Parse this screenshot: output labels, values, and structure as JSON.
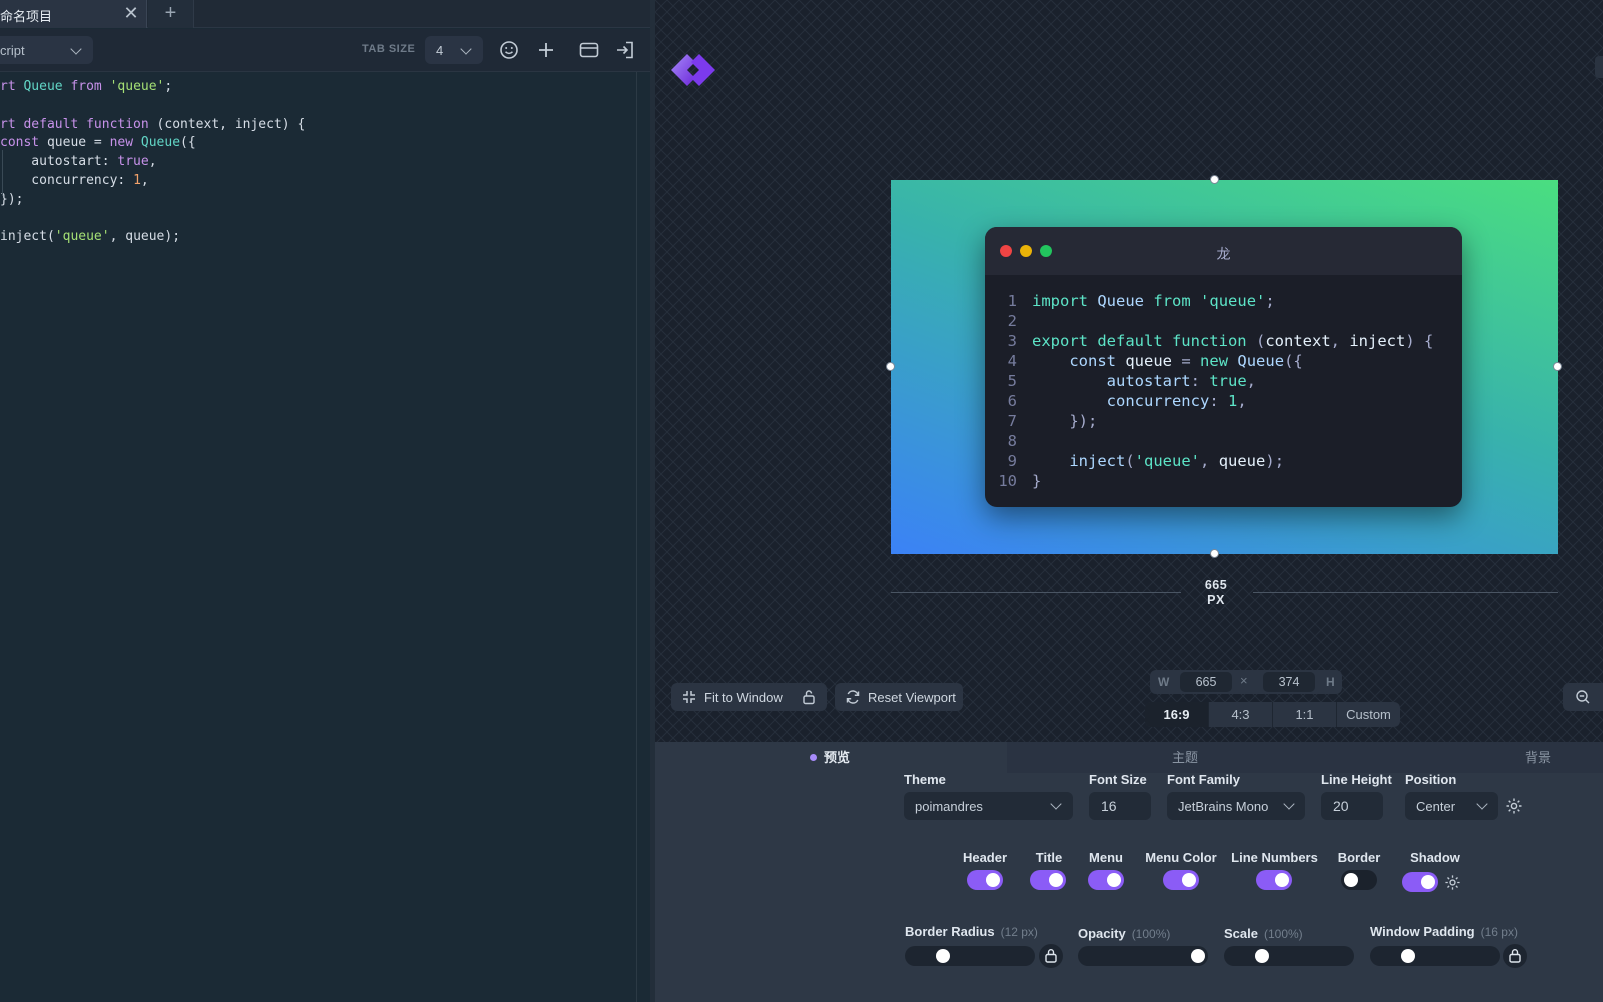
{
  "editor": {
    "tab_label": "命名项目",
    "tab_close": "✕",
    "tab_add": "+",
    "language": "cript",
    "tab_size_label": "TAB SIZE",
    "tab_size_value": "4",
    "lines": [
      "rt Queue from 'queue';",
      "",
      "rt default function (context, inject) {",
      "const queue = new Queue({",
      "    autostart: true,",
      "    concurrency: 1,",
      "});",
      "",
      "inject('queue', queue);"
    ]
  },
  "preview": {
    "window_title": "龙",
    "code_lines": [
      {
        "n": "1",
        "t": "import Queue from 'queue';"
      },
      {
        "n": "2",
        "t": ""
      },
      {
        "n": "3",
        "t": "export default function (context, inject) {"
      },
      {
        "n": "4",
        "t": "    const queue = new Queue({"
      },
      {
        "n": "5",
        "t": "        autostart: true,"
      },
      {
        "n": "6",
        "t": "        concurrency: 1,"
      },
      {
        "n": "7",
        "t": "    });"
      },
      {
        "n": "8",
        "t": ""
      },
      {
        "n": "9",
        "t": "    inject('queue', queue);"
      },
      {
        "n": "10",
        "t": "}"
      }
    ],
    "width_value": "665",
    "width_unit": "PX",
    "fit_label": "Fit to Window",
    "reset_label": "Reset Viewport",
    "dims": {
      "w_label": "W",
      "w_value": "665",
      "x": "×",
      "h_value": "374",
      "h_label": "H"
    },
    "ratios": [
      "16:9",
      "4:3",
      "1:1",
      "Custom"
    ],
    "active_ratio": "16:9",
    "colors": {
      "gradient_start": "#3b82f6",
      "gradient_mid": "#38b2ac",
      "gradient_end": "#4ade80",
      "accent": "#8b5cf6"
    }
  },
  "panel": {
    "tabs": [
      "预览",
      "主题",
      "背景"
    ],
    "theme": {
      "label": "Theme",
      "value": "poimandres"
    },
    "font_size": {
      "label": "Font Size",
      "value": "16"
    },
    "font_family": {
      "label": "Font Family",
      "value": "JetBrains Mono"
    },
    "line_height": {
      "label": "Line Height",
      "value": "20"
    },
    "position": {
      "label": "Position",
      "value": "Center"
    },
    "toggles": [
      {
        "label": "Header",
        "on": true
      },
      {
        "label": "Title",
        "on": true
      },
      {
        "label": "Menu",
        "on": true
      },
      {
        "label": "Menu Color",
        "on": true
      },
      {
        "label": "Line Numbers",
        "on": true
      },
      {
        "label": "Border",
        "on": false
      },
      {
        "label": "Shadow",
        "on": true
      }
    ],
    "border_radius": {
      "label": "Border Radius",
      "sub": "(12 px)",
      "level": 0.25
    },
    "opacity": {
      "label": "Opacity",
      "sub": "(100%)",
      "level": 1.0
    },
    "scale": {
      "label": "Scale",
      "sub": "(100%)",
      "level": 0.25
    },
    "window_padding": {
      "label": "Window Padding",
      "sub": "(16 px)",
      "level": 0.25
    }
  }
}
